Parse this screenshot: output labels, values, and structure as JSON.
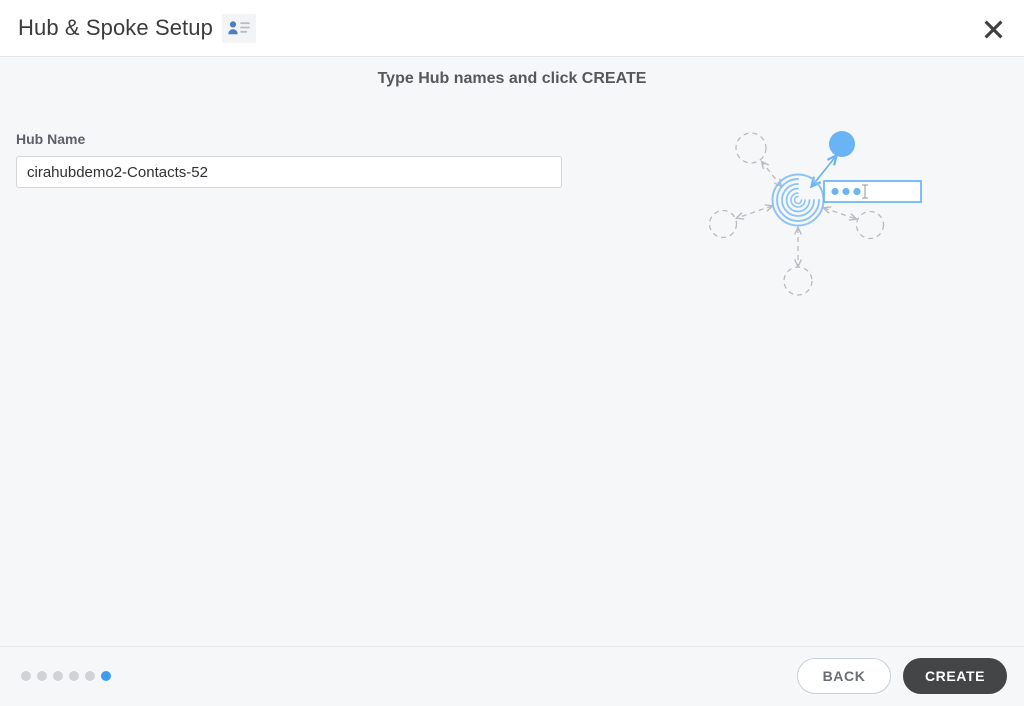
{
  "header": {
    "title": "Hub & Spoke Setup",
    "badge_icon": "contact-card-icon",
    "close_icon": "close-icon"
  },
  "main": {
    "subtitle": "Type Hub names and click CREATE",
    "field": {
      "label": "Hub Name",
      "value": "cirahubdemo2-Contacts-52",
      "placeholder": "Hub Name"
    }
  },
  "illustration": {
    "name": "hub-and-spoke-diagram",
    "hub_icon": "spiral-hub-icon",
    "active_node_icon": "blue-node-icon",
    "text_box_icon": "typing-textbox-icon",
    "spoke_count": 4,
    "colors": {
      "accent": "#6ab4f5",
      "dashed": "#b9bcbf"
    }
  },
  "footer": {
    "steps": {
      "total": 6,
      "active_index": 6
    },
    "back_label": "BACK",
    "create_label": "CREATE"
  },
  "colors": {
    "accent_blue": "#3b9cf0",
    "primary_button": "#444547",
    "background": "#f6f7f9",
    "header_background": "#ffffff",
    "title_text": "#3b3b3d"
  }
}
